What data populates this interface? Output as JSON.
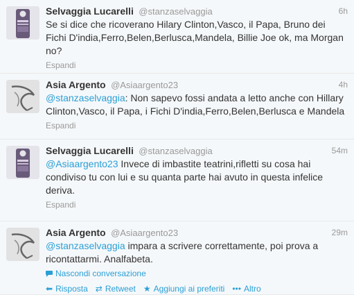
{
  "tweets": [
    {
      "fullname": "Selvaggia Lucarelli",
      "username": "@stanzaselvaggia",
      "time": "6h",
      "text": "Se si dice che ricoverano Hilary Clinton,Vasco, il Papa, Bruno dei Fichi D'india,Ferro,Belen,Berlusca,Mandela, Billie Joe ok, ma Morgan no?",
      "footer": "Espandi"
    },
    {
      "fullname": "Asia Argento",
      "username": "@Asiaargento23",
      "time": "4h",
      "mention": "@stanzaselvaggia",
      "text": ": Non sapevo fossi andata a letto anche con Hillary Clinton,Vasco, il Papa, i Fichi D'india,Ferro,Belen,Berlusca e Mandela",
      "footer": "Espandi"
    },
    {
      "fullname": "Selvaggia Lucarelli",
      "username": "@stanzaselvaggia",
      "time": "54m",
      "mention": "@Asiaargento23",
      "text": " Invece di imbastite teatrini,rifletti su cosa hai condiviso tu con lui e su quanta parte hai avuto in questa infelice deriva.",
      "footer": "Espandi"
    },
    {
      "fullname": "Asia Argento",
      "username": "@Asiaargento23",
      "time": "29m",
      "mention": "@stanzaselvaggia",
      "text": " impara a scrivere correttamente, poi prova a ricontattarmi. Analfabeta.",
      "conversation": "Nascondi conversazione",
      "actions": {
        "reply": "Risposta",
        "retweet": "Retweet",
        "favorite": "Aggiungi ai preferiti",
        "more": "Altro"
      }
    }
  ],
  "icons": {
    "reply": "reply-arrow-icon",
    "retweet": "retweet-icon",
    "favorite": "star-icon",
    "more": "more-dots-icon",
    "conversation": "speech-bubble-icon"
  },
  "colors": {
    "link": "#2a9fd6",
    "muted": "#999999",
    "text": "#333333"
  }
}
